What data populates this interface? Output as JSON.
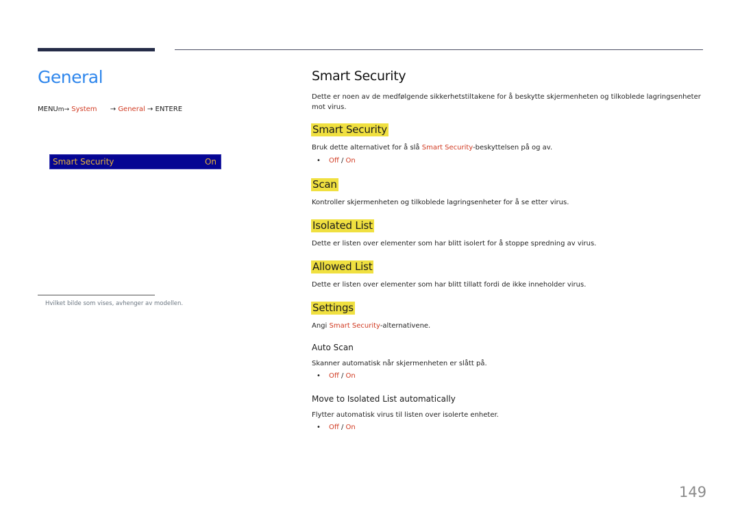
{
  "left": {
    "title": "General",
    "breadcrumb": {
      "menu": "MENU",
      "menu_icon": "m-arrow",
      "system": "System",
      "arrow1": "→",
      "general": "General",
      "arrow2": "→",
      "enter": "ENTER",
      "enter_suffix": "E"
    },
    "osd": {
      "label": "Smart Security",
      "value": "On"
    },
    "footnote": "Hvilket bilde som vises, avhenger av modellen."
  },
  "main": {
    "title": "Smart Security",
    "intro": "Dette er noen av de medfølgende sikkerhetstiltakene for å beskytte skjermenheten og tilkoblede lagringsenheter mot virus.",
    "sections": [
      {
        "heading": "Smart Security",
        "text_before": "Bruk dette alternativet for å slå ",
        "text_link": "Smart Security",
        "text_after": "-beskyttelsen på og av.",
        "option_off": "Off",
        "option_sep": " / ",
        "option_on": "On"
      },
      {
        "heading": "Scan",
        "text": "Kontroller skjermenheten og tilkoblede lagringsenheter for å se etter virus."
      },
      {
        "heading": "Isolated List",
        "text": "Dette er listen over elementer som har blitt isolert for å stoppe spredning av virus."
      },
      {
        "heading": "Allowed List",
        "text": "Dette er listen over elementer som har blitt tillatt fordi de ikke inneholder virus."
      },
      {
        "heading": "Settings",
        "text_before": "Angi ",
        "text_link": "Smart Security",
        "text_after": "-alternativene."
      }
    ],
    "subsections": [
      {
        "heading": "Auto Scan",
        "text": "Skanner automatisk når skjermenheten er slått på.",
        "option_off": "Off",
        "option_sep": " / ",
        "option_on": "On"
      },
      {
        "heading": "Move to Isolated List automatically",
        "text": "Flytter automatisk virus til listen over isolerte enheter.",
        "option_off": "Off",
        "option_sep": " / ",
        "option_on": "On"
      }
    ]
  },
  "page_number": "149",
  "colors": {
    "title_blue": "#2e86ec",
    "link_red": "#d0381f",
    "highlight_yellow": "#f0e040",
    "osd_background": "#050593",
    "osd_text": "#e8b23a",
    "header_bar": "#252c48"
  }
}
